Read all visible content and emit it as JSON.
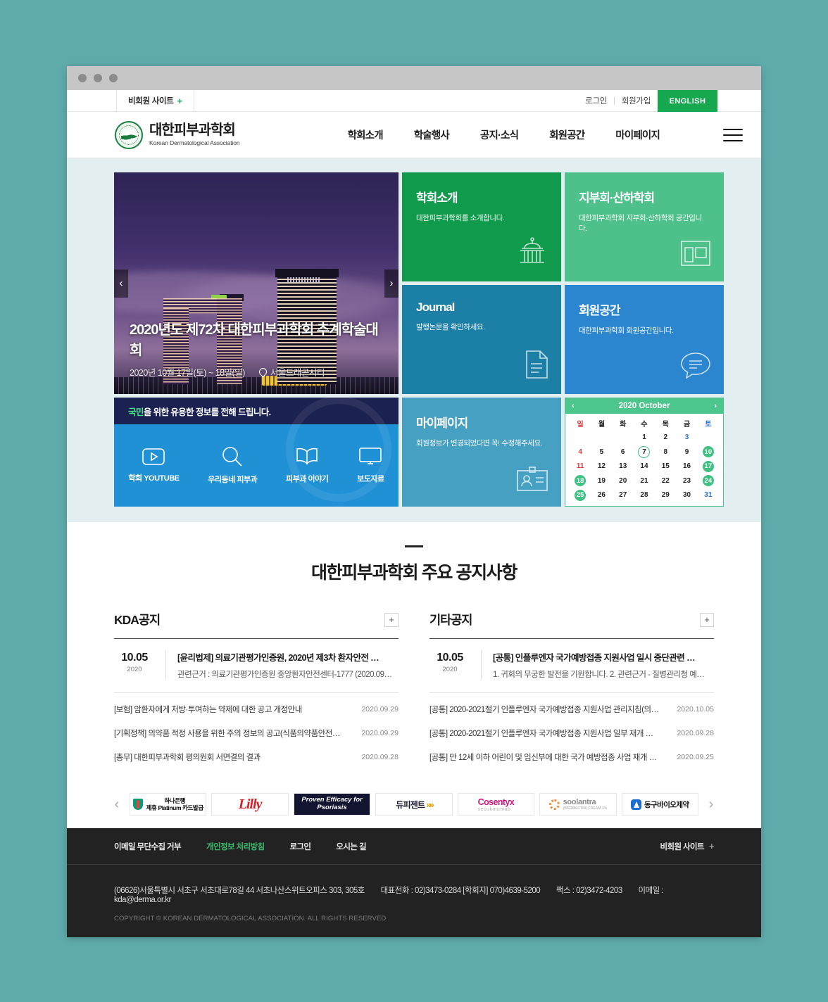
{
  "utilbar": {
    "nonmember_site": "비회원 사이트",
    "plus": "+",
    "login": "로그인",
    "sep": "|",
    "join": "회원가입",
    "english": "ENGLISH"
  },
  "header": {
    "brand_ko": "대한피부과학회",
    "brand_en": "Korean Dermatological Association",
    "nav": [
      {
        "label": "학회소개"
      },
      {
        "label": "학술행사"
      },
      {
        "label": "공지·소식"
      },
      {
        "label": "회원공간"
      },
      {
        "label": "마이페이지"
      }
    ]
  },
  "slider": {
    "title": "2020년도 제72차 대한피부과학회 추계학술대회",
    "date": "2020년 10월 17일(토) ~ 18일(일)",
    "place": "서울드래곤시티",
    "prev": "‹",
    "next": "›"
  },
  "tiles": [
    {
      "title": "학회소개",
      "desc": "대한피부과학회를 소개합니다.",
      "icon": "institution-icon",
      "color": "#109a4c"
    },
    {
      "title": "지부회·산하학회",
      "desc": "대한피부과학회 지부회·산하학회 공간입니다.",
      "icon": "layout-icon",
      "color": "#4ec08a"
    },
    {
      "title": "Journal",
      "desc": "발행논문을 확인하세요.",
      "icon": "document-icon",
      "color": "#1b7fa6"
    },
    {
      "title": "회원공간",
      "desc": "대한피부과학회 회원공간입니다.",
      "icon": "chat-icon",
      "color": "#2b86cf"
    },
    {
      "title": "마이페이지",
      "desc": "회원정보가 변경되었다면 꼭! 수정해주세요.",
      "icon": "id-card-icon",
      "color": "#46a0c2"
    }
  ],
  "public_info": {
    "highlight": "국민",
    "headline_rest": "을 위한 유용한 정보를 전해 드립니다.",
    "items": [
      {
        "label": "학회 YOUTUBE",
        "icon": "youtube-icon"
      },
      {
        "label": "우리동네 피부과",
        "icon": "search-icon"
      },
      {
        "label": "피부과 이야기",
        "icon": "book-icon"
      },
      {
        "label": "보도자료",
        "icon": "monitor-icon"
      }
    ]
  },
  "calendar": {
    "title": "2020 October",
    "prev": "‹",
    "next": "›",
    "dow": [
      "일",
      "월",
      "화",
      "수",
      "목",
      "금",
      "토"
    ],
    "cells": [
      {
        "d": "",
        "k": ""
      },
      {
        "d": "",
        "k": ""
      },
      {
        "d": "",
        "k": ""
      },
      {
        "d": "1",
        "k": ""
      },
      {
        "d": "2",
        "k": ""
      },
      {
        "d": "3",
        "k": "sat"
      },
      {
        "d": "",
        "k": ""
      },
      {
        "d": "4",
        "k": "sun"
      },
      {
        "d": "5",
        "k": ""
      },
      {
        "d": "6",
        "k": ""
      },
      {
        "d": "7",
        "k": "today"
      },
      {
        "d": "8",
        "k": ""
      },
      {
        "d": "9",
        "k": ""
      },
      {
        "d": "10",
        "k": "ev"
      },
      {
        "d": "11",
        "k": "sun"
      },
      {
        "d": "12",
        "k": ""
      },
      {
        "d": "13",
        "k": ""
      },
      {
        "d": "14",
        "k": ""
      },
      {
        "d": "15",
        "k": ""
      },
      {
        "d": "16",
        "k": ""
      },
      {
        "d": "17",
        "k": "ev"
      },
      {
        "d": "18",
        "k": "ev"
      },
      {
        "d": "19",
        "k": ""
      },
      {
        "d": "20",
        "k": ""
      },
      {
        "d": "21",
        "k": ""
      },
      {
        "d": "22",
        "k": ""
      },
      {
        "d": "23",
        "k": ""
      },
      {
        "d": "24",
        "k": "ev"
      },
      {
        "d": "25",
        "k": "ev"
      },
      {
        "d": "26",
        "k": ""
      },
      {
        "d": "27",
        "k": ""
      },
      {
        "d": "28",
        "k": ""
      },
      {
        "d": "29",
        "k": ""
      },
      {
        "d": "30",
        "k": ""
      },
      {
        "d": "31",
        "k": "sat"
      }
    ],
    "note_cells_order": "row-major with first row offset so that 1 falls on 수(Wed); 3 and 31 are Saturdays"
  },
  "notices": {
    "section_title": "대한피부과학회 주요 공지사항",
    "columns": [
      {
        "heading": "KDA공지",
        "more": "+",
        "feature": {
          "day": "10.05",
          "year": "2020",
          "title": "[윤리법제] 의료기관평가인증원, 2020년 제3차 환자안전 …",
          "desc": "관련근거 : 의료기관평가인증원 중앙환자안전센터-1777 (2020.09…"
        },
        "items": [
          {
            "title": "[보험] 암환자에게 처방·투여하는 약제에 대한 공고 개정안내",
            "date": "2020.09.29"
          },
          {
            "title": "[기획정책] 의약품 적정 사용을 위한 주의 정보의 공고(식품의약품안전…",
            "date": "2020.09.29"
          },
          {
            "title": "[총무] 대한피부과학회 평의원회 서면결의 결과",
            "date": "2020.09.28"
          }
        ]
      },
      {
        "heading": "기타공지",
        "more": "+",
        "feature": {
          "day": "10.05",
          "year": "2020",
          "title": "[공통] 인플루엔자 국가예방접종 지원사업 일시 중단관련 …",
          "desc": "1. 귀회의 무궁한 발전을 기원합니다. 2. 관련근거 - 질병관리청 예…"
        },
        "items": [
          {
            "title": "[공통] 2020-2021절기 인플루엔자 국가예방접종 지원사업 관리지침(의…",
            "date": "2020.10.05"
          },
          {
            "title": "[공통] 2020-2021절기 인플루엔자 국가예방접종 지원사업 일부 재개 …",
            "date": "2020.09.28"
          },
          {
            "title": "[공통] 만 12세 이하 어린이 및 임신부에 대한 국가 예방접종 사업 재개 …",
            "date": "2020.09.25"
          }
        ]
      }
    ]
  },
  "sponsors": {
    "prev": "‹",
    "next": "›",
    "items": [
      {
        "name": "하나은행",
        "sub": "제휴 Platinum 카드발급",
        "kind": "hana"
      },
      {
        "name": "Lilly",
        "kind": "lilly"
      },
      {
        "name": "Proven Efficacy for Psoriasis",
        "kind": "psoriasis"
      },
      {
        "name": "듀피젠트",
        "kind": "dupixent"
      },
      {
        "name": "Cosentyx",
        "sub": "secukinumab",
        "kind": "cosentyx"
      },
      {
        "name": "soolantra",
        "sub": "(IVERMECTIN) CREAM 1%",
        "kind": "soolantra"
      },
      {
        "name": "동구바이오제약",
        "kind": "dongkoo"
      }
    ]
  },
  "footer": {
    "links": [
      {
        "label": "이메일 무단수집 거부",
        "accent": false
      },
      {
        "label": "개인정보 처리방침",
        "accent": true
      },
      {
        "label": "로그인",
        "accent": false
      },
      {
        "label": "오시는 길",
        "accent": false
      }
    ],
    "nonmember": "비회원 사이트",
    "nonmember_plus": "+",
    "address": "(06626)서울특별시 서초구 서초대로78길 44 서초나산스위트오피스 303, 305호",
    "tel": "대표전화 : 02)3473-0284 [학회지] 070)4639-5200",
    "fax": "팩스 : 02)3472-4203",
    "email": "이메일 : kda@derma.or.kr",
    "copyright": "COPYRIGHT © KOREAN DERMATOLOGICAL ASSOCIATION. ALL RIGHTS RESERVED."
  }
}
